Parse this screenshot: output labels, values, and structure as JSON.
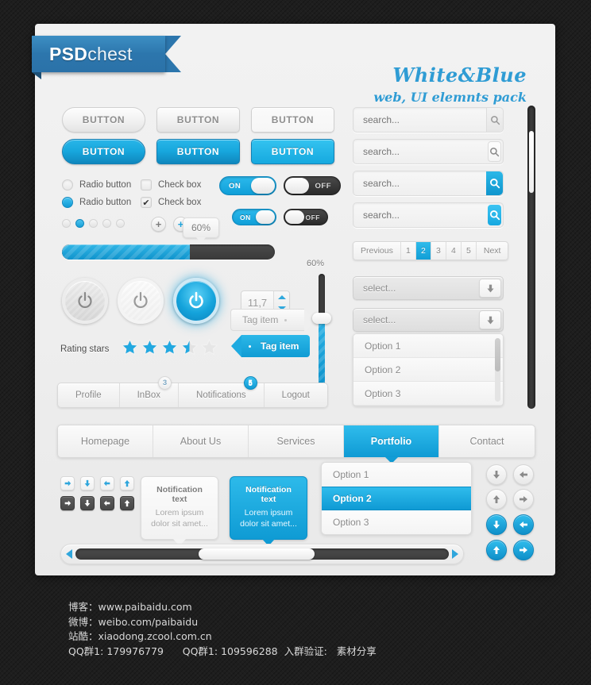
{
  "brand": {
    "bold": "PSD",
    "light": "chest"
  },
  "header": {
    "title": "White&Blue",
    "subtitle": "web, UI elemnts pack"
  },
  "buttons": {
    "grey": [
      "BUTTON",
      "BUTTON",
      "BUTTON"
    ],
    "blue": [
      "BUTTON",
      "BUTTON",
      "BUTTON"
    ]
  },
  "controls": {
    "radio_label_1": "Radio button",
    "radio_label_2": "Radio button",
    "check_label_1": "Check box",
    "check_label_2": "Check box",
    "check_mark": "✔",
    "toggle_on": "ON",
    "toggle_off": "OFF"
  },
  "plus": {
    "grey": "+",
    "blue": "+"
  },
  "progress": {
    "value": 60,
    "tooltip": "60%"
  },
  "slider": {
    "value": 60,
    "label": "60%"
  },
  "spinner": {
    "value": "11,7"
  },
  "tags": {
    "grey": "Tag item",
    "blue": "Tag item"
  },
  "rating": {
    "label": "Rating stars",
    "value": 3.5,
    "max": 5
  },
  "account_tabs": [
    {
      "label": "Profile",
      "badge": null,
      "badge_style": null
    },
    {
      "label": "InBox",
      "badge": "3",
      "badge_style": "grey"
    },
    {
      "label": "Notifications",
      "badge": "5",
      "badge_style": "blue"
    },
    {
      "label": "Logout",
      "badge": null,
      "badge_style": null
    }
  ],
  "search": {
    "placeholder": "search...",
    "fields": [
      "search...",
      "search...",
      "search...",
      "search..."
    ]
  },
  "pagination": {
    "previous": "Previous",
    "pages": [
      "1",
      "2",
      "3",
      "4",
      "5"
    ],
    "active": "2",
    "next": "Next"
  },
  "selects": {
    "placeholder_1": "select...",
    "placeholder_2": "select...",
    "options": [
      "Option 1",
      "Option 2",
      "Option 3"
    ]
  },
  "nav": {
    "items": [
      "Homepage",
      "About Us",
      "Services",
      "Portfolio",
      "Contact"
    ],
    "active": "Portfolio"
  },
  "notifications": {
    "grey": {
      "title": "Notification text",
      "body": "Lorem ipsum dolor sit amet..."
    },
    "blue": {
      "title": "Notification text",
      "body": "Lorem ipsum dolor sit amet..."
    }
  },
  "dropdown": {
    "options": [
      "Option 1",
      "Option 2",
      "Option 3"
    ],
    "selected": "Option 2"
  },
  "footer": {
    "line1": "博客：www.paibaidu.com",
    "line2": "微博：weibo.com/paibaidu",
    "line3": "站酷：xiaodong.zcool.com.cn",
    "line4": "QQ群1: 179976779      QQ群1: 109596288  入群验证:   素材分享"
  },
  "colors": {
    "accent": "#17a7dd",
    "accent_dark": "#0f86bd",
    "panel": "#eeeeee",
    "background": "#1e1e1e"
  }
}
